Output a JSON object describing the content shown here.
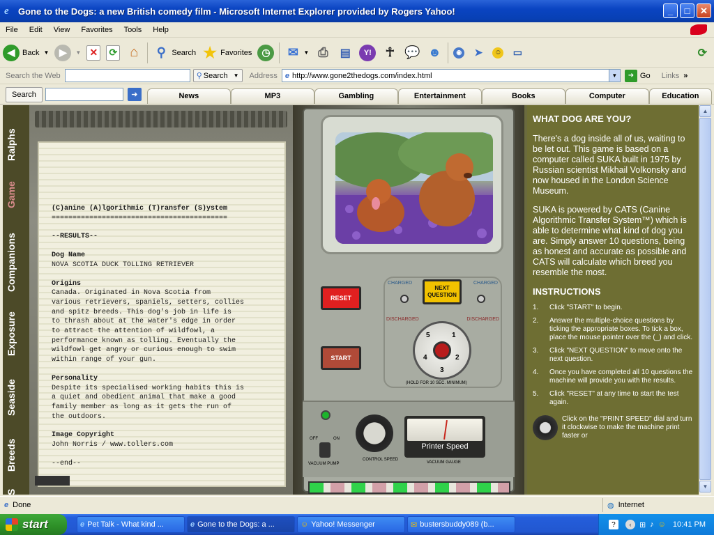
{
  "window": {
    "title": "Gone to the Dogs: a new British comedy film - Microsoft Internet Explorer provided by Rogers Yahoo!"
  },
  "menu": [
    "File",
    "Edit",
    "View",
    "Favorites",
    "Tools",
    "Help"
  ],
  "toolbar": {
    "back": "Back",
    "search": "Search",
    "favorites": "Favorites"
  },
  "addressbar": {
    "search_label": "Search the Web",
    "search_button": "Search",
    "address_label": "Address",
    "url": "http://www.gone2thedogs.com/index.html",
    "go": "Go",
    "links": "Links"
  },
  "yahoobar": {
    "search_label": "Search",
    "tabs": [
      "News",
      "MP3",
      "Gambling",
      "Entertainment",
      "Books",
      "Computer",
      "Education"
    ]
  },
  "sidenav": [
    "Ralphs",
    "Game",
    "Companions",
    "Exposure",
    "Seaside",
    "Breeds",
    "S"
  ],
  "printout": {
    "header": "(C)anine (A)lgorithmic (T)ransfer (S)ystem",
    "rule": "==========================================",
    "results": "--RESULTS--",
    "dog_name_label": "Dog Name",
    "dog_name": "NOVA SCOTIA DUCK TOLLING RETRIEVER",
    "origins_label": "Origins",
    "origins_text": "Canada.  Originated in Nova Scotia from\nvarious retrievers, spaniels, setters, collies\nand spitz breeds.  This dog's job in life is\nto thrash about at the water's edge in order\nto attract the attention of wildfowl, a\nperformance known as tolling.  Eventually the\nwildfowl get angry or curious enough to swim\nwithin range of your gun.",
    "personality_label": "Personality",
    "personality_text": "Despite its specialised working habits this is\na quiet and obedient animal that make a good\nfamily member as long as it gets the run of\nthe outdoors.",
    "copyright_label": "Image Copyright",
    "copyright_text": "John Norris / www.tollers.com",
    "end": "--end--"
  },
  "machine": {
    "reset": "RESET",
    "start": "START",
    "next_question": "NEXT QUESTION",
    "charged": "CHARGED",
    "discharged": "DISCHARGED",
    "hold_note": "(HOLD FOR 10 SEC. MINIMUM)",
    "dial_numbers": [
      "1",
      "2",
      "3",
      "4",
      "5"
    ],
    "off": "OFF",
    "on": "ON",
    "vacuum_pump": "VACUUM PUMP",
    "control_speed": "CONTROL SPEED",
    "printer_speed": "Printer Speed",
    "vacuum_gauge": "VACUUM GAUGE"
  },
  "rightpane": {
    "heading": "WHAT DOG ARE YOU?",
    "para1": "There's a dog inside all of us, waiting to be let out. This game is based on a computer called SUKA built in 1975 by Russian scientist Mikhail Volkonsky and now housed in the London Science Museum.",
    "para2": "SUKA is powered by CATS (Canine Algorithmic Transfer System™) which is able to determine what kind of dog you are. Simply answer 10 questions, being as honest and accurate as possible and CATS will calculate which breed you resemble the most.",
    "instructions_heading": "INSTRUCTIONS",
    "steps": [
      {
        "n": "1.",
        "text": "Click \"START\" to begin."
      },
      {
        "n": "2.",
        "text": "Answer the multiple-choice questions by ticking the appropriate boxes. To tick a box, place the mouse pointer over the (_) and click."
      },
      {
        "n": "3.",
        "text": "Click \"NEXT QUESTION\" to move onto the next question."
      },
      {
        "n": "4.",
        "text": "Once you have completed all 10 questions the machine will provide you with the results."
      },
      {
        "n": "5.",
        "text": "Click \"RESET\" at any time to start the test again."
      }
    ],
    "tip": "Click on the \"PRINT SPEED\" dial and turn it clockwise to make the machine print faster or"
  },
  "status": {
    "text": "Done",
    "zone": "Internet"
  },
  "taskbar": {
    "start": "start",
    "tasks": [
      "Pet Talk - What kind ...",
      "Gone to the Dogs: a ...",
      "Yahoo! Messenger",
      "bustersbuddy089  (b..."
    ],
    "time": "10:41 PM"
  },
  "colors": {
    "title_blue": "#0a44c2",
    "content_olive": "#6e6e33",
    "reset_red": "#e02020",
    "next_yellow": "#f2c200",
    "nav_game_pink": "#d98c8c"
  }
}
